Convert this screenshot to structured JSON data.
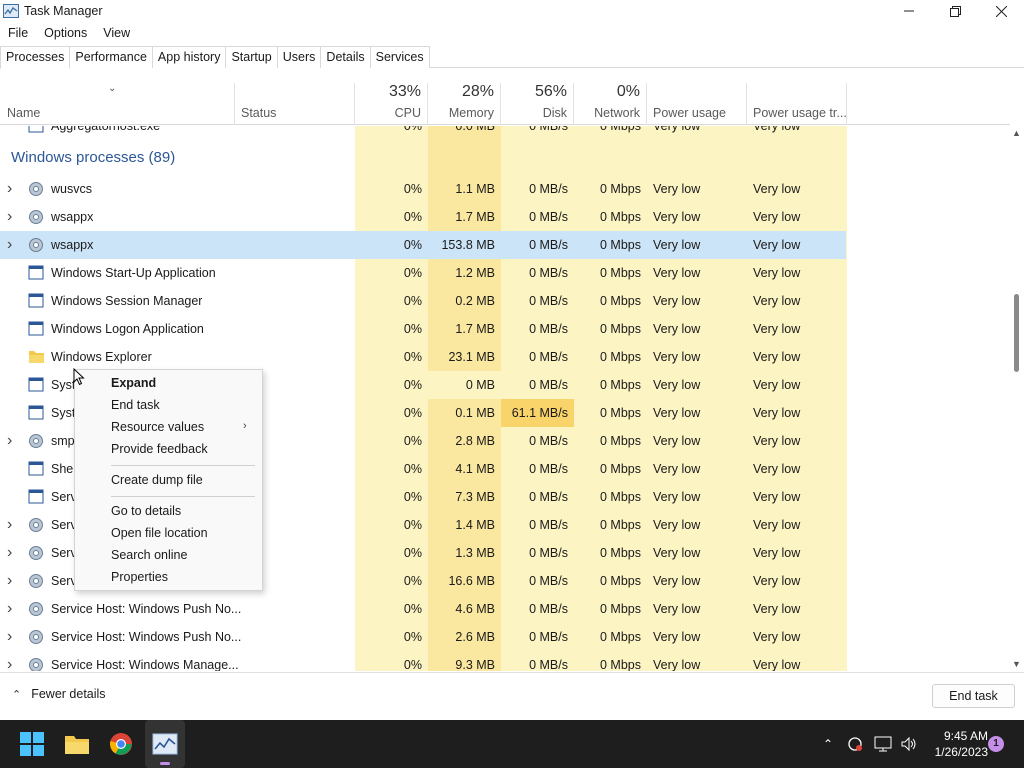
{
  "window": {
    "title": "Task Manager"
  },
  "menu": [
    "File",
    "Options",
    "View"
  ],
  "tabs": [
    "Processes",
    "Performance",
    "App history",
    "Startup",
    "Users",
    "Details",
    "Services"
  ],
  "header": {
    "name": "Name",
    "status": "Status",
    "cpu": {
      "pct": "33%",
      "label": "CPU"
    },
    "memory": {
      "pct": "28%",
      "label": "Memory"
    },
    "disk": {
      "pct": "56%",
      "label": "Disk"
    },
    "network": {
      "pct": "0%",
      "label": "Network"
    },
    "power": "Power usage",
    "power_trend": "Power usage tr..."
  },
  "partial_row": {
    "name": "Aggregatorhost.exe",
    "cpu": "0%",
    "memory": "0.0 MB",
    "disk": "0 MB/s",
    "network": "0 Mbps",
    "power": "Very low",
    "trend": "Very low"
  },
  "group_title": "Windows processes (89)",
  "rows": [
    {
      "name": "wusvcs",
      "cpu": "0%",
      "memory": "1.1 MB",
      "disk": "0 MB/s",
      "network": "0 Mbps",
      "power": "Very low",
      "trend": "Very low",
      "expandable": true,
      "icon": "gear-icon",
      "selected": false
    },
    {
      "name": "wsappx",
      "cpu": "0%",
      "memory": "1.7 MB",
      "disk": "0 MB/s",
      "network": "0 Mbps",
      "power": "Very low",
      "trend": "Very low",
      "expandable": true,
      "icon": "gear-icon",
      "selected": false
    },
    {
      "name": "wsappx",
      "cpu": "0%",
      "memory": "153.8 MB",
      "disk": "0 MB/s",
      "network": "0 Mbps",
      "power": "Very low",
      "trend": "Very low",
      "expandable": true,
      "icon": "gear-icon",
      "selected": true
    },
    {
      "name": "Windows Start-Up Application",
      "cpu": "0%",
      "memory": "1.2 MB",
      "disk": "0 MB/s",
      "network": "0 Mbps",
      "power": "Very low",
      "trend": "Very low",
      "expandable": false,
      "icon": "window-icon",
      "selected": false
    },
    {
      "name": "Windows Session Manager",
      "cpu": "0%",
      "memory": "0.2 MB",
      "disk": "0 MB/s",
      "network": "0 Mbps",
      "power": "Very low",
      "trend": "Very low",
      "expandable": false,
      "icon": "window-icon",
      "selected": false
    },
    {
      "name": "Windows Logon Application",
      "cpu": "0%",
      "memory": "1.7 MB",
      "disk": "0 MB/s",
      "network": "0 Mbps",
      "power": "Very low",
      "trend": "Very low",
      "expandable": false,
      "icon": "window-icon",
      "selected": false
    },
    {
      "name": "Windows Explorer",
      "cpu": "0%",
      "memory": "23.1 MB",
      "disk": "0 MB/s",
      "network": "0 Mbps",
      "power": "Very low",
      "trend": "Very low",
      "expandable": false,
      "icon": "folder-icon",
      "selected": false
    },
    {
      "name": "Syst",
      "cpu": "0%",
      "memory": "0 MB",
      "disk": "0 MB/s",
      "network": "0 Mbps",
      "power": "Very low",
      "trend": "Very low",
      "expandable": false,
      "icon": "window-icon",
      "selected": false
    },
    {
      "name": "Syst",
      "cpu": "0%",
      "memory": "0.1 MB",
      "disk": "61.1 MB/s",
      "network": "0 Mbps",
      "power": "Very low",
      "trend": "Very low",
      "expandable": false,
      "icon": "window-icon",
      "selected": false
    },
    {
      "name": "smp",
      "cpu": "0%",
      "memory": "2.8 MB",
      "disk": "0 MB/s",
      "network": "0 Mbps",
      "power": "Very low",
      "trend": "Very low",
      "expandable": true,
      "icon": "gear-icon",
      "selected": false
    },
    {
      "name": "Shel",
      "cpu": "0%",
      "memory": "4.1 MB",
      "disk": "0 MB/s",
      "network": "0 Mbps",
      "power": "Very low",
      "trend": "Very low",
      "expandable": false,
      "icon": "window-icon",
      "selected": false
    },
    {
      "name": "Serv",
      "cpu": "0%",
      "memory": "7.3 MB",
      "disk": "0 MB/s",
      "network": "0 Mbps",
      "power": "Very low",
      "trend": "Very low",
      "expandable": false,
      "icon": "window-icon",
      "selected": false
    },
    {
      "name": "Serv",
      "cpu": "0%",
      "memory": "1.4 MB",
      "disk": "0 MB/s",
      "network": "0 Mbps",
      "power": "Very low",
      "trend": "Very low",
      "expandable": true,
      "icon": "gear-icon",
      "selected": false
    },
    {
      "name": "Serv",
      "cpu": "0%",
      "memory": "1.3 MB",
      "disk": "0 MB/s",
      "network": "0 Mbps",
      "power": "Very low",
      "trend": "Very low",
      "expandable": true,
      "icon": "gear-icon",
      "selected": false
    },
    {
      "name": "Serv",
      "cpu": "0%",
      "memory": "16.6 MB",
      "disk": "0 MB/s",
      "network": "0 Mbps",
      "power": "Very low",
      "trend": "Very low",
      "expandable": true,
      "icon": "gear-icon",
      "selected": false
    },
    {
      "name": "Service Host: Windows Push No...",
      "cpu": "0%",
      "memory": "4.6 MB",
      "disk": "0 MB/s",
      "network": "0 Mbps",
      "power": "Very low",
      "trend": "Very low",
      "expandable": true,
      "icon": "gear-icon",
      "selected": false
    },
    {
      "name": "Service Host: Windows Push No...",
      "cpu": "0%",
      "memory": "2.6 MB",
      "disk": "0 MB/s",
      "network": "0 Mbps",
      "power": "Very low",
      "trend": "Very low",
      "expandable": true,
      "icon": "gear-icon",
      "selected": false
    },
    {
      "name": "Service Host: Windows Manage...",
      "cpu": "0%",
      "memory": "9.3 MB",
      "disk": "0 MB/s",
      "network": "0 Mbps",
      "power": "Very low",
      "trend": "Very low",
      "expandable": true,
      "icon": "gear-icon",
      "selected": false
    }
  ],
  "context_menu": {
    "expand": "Expand",
    "end_task": "End task",
    "resource_values": "Resource values",
    "provide_feedback": "Provide feedback",
    "create_dump": "Create dump file",
    "go_to_details": "Go to details",
    "open_file_location": "Open file location",
    "search_online": "Search online",
    "properties": "Properties"
  },
  "footer": {
    "fewer_details": "Fewer details",
    "end_task": "End task"
  },
  "taskbar": {
    "time": "9:45 AM",
    "date": "1/26/2023",
    "notifications": "1"
  },
  "colors": {
    "heat_light": "#fdf4c4",
    "heat_med": "#fbe8a0",
    "heat_hot": "#f9d46a",
    "selected": "#cce4f7",
    "group_title": "#2b5797",
    "accent": "#c58ee8"
  }
}
